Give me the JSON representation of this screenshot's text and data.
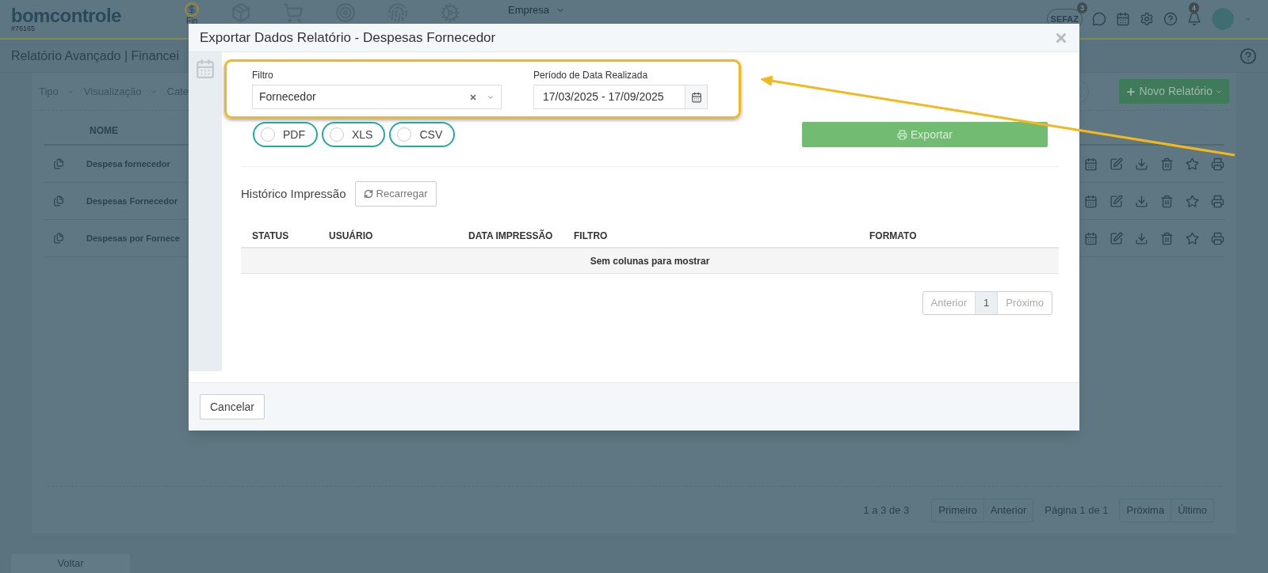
{
  "header": {
    "logo": "bomcontrole",
    "account": "#76165",
    "nav_label": "Fin",
    "company_menu": "Empresa",
    "sefaz": {
      "label": "SEFAZ",
      "count": "3"
    },
    "notifications_count": "4"
  },
  "page": {
    "title": "Relatório Avançado | Financei",
    "filters": [
      "Tipo",
      "Visualização",
      "Cate"
    ],
    "new_report_button": "Novo Relatório",
    "table": {
      "column": "NOME",
      "rows": [
        "Despesa fornecedor",
        "Despesas Fornecedor",
        "Despesas por Fornece"
      ]
    },
    "pagination": {
      "range": "1 a 3 de 3",
      "first": "Primeiro",
      "previous": "Anterior",
      "page_info": "Página 1 de 1",
      "next": "Próxima",
      "last": "Último"
    },
    "back_button": "Voltar"
  },
  "modal": {
    "title": "Exportar Dados Relatório - Despesas Fornecedor",
    "filter": {
      "label": "Filtro",
      "value": "Fornecedor"
    },
    "period": {
      "label": "Período de Data Realizada",
      "value": "17/03/2025 - 17/09/2025"
    },
    "formats": [
      {
        "label": "PDF",
        "selected": false
      },
      {
        "label": "XLS",
        "selected": false
      },
      {
        "label": "CSV",
        "selected": false
      }
    ],
    "export_button": {
      "label": "Exportar",
      "disabled": true
    },
    "history": {
      "title": "Histórico Impressão",
      "reload_button": "Recarregar",
      "columns": [
        "STATUS",
        "USUÁRIO",
        "DATA IMPRESSÃO",
        "FILTRO",
        "FORMATO"
      ],
      "empty_message": "Sem colunas para mostrar",
      "pagination": {
        "previous": "Anterior",
        "pages": [
          {
            "label": "1",
            "selected": true
          }
        ],
        "next": "Próximo"
      }
    },
    "cancel_button": "Cancelar"
  }
}
